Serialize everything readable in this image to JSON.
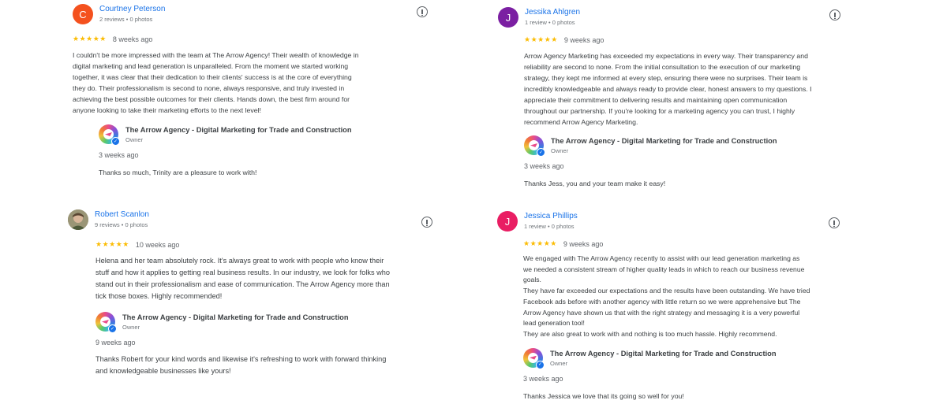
{
  "reviews": [
    {
      "avatar": {
        "letter": "C",
        "color": "#f4511e"
      },
      "name": "Courtney Peterson",
      "stats": "2 reviews • 0 photos",
      "stars": "★★★★★",
      "date": "8 weeks ago",
      "text": [
        "I couldn't be more impressed with the team at The Arrow Agency! Their wealth of knowledge in",
        "digital marketing and lead generation is unparalleled. From the moment we started working",
        "together, it was clear that their dedication to their clients' success is at the core of everything",
        "they do. Their professionalism is second to none, always responsive, and truly invested in",
        "achieving the best possible outcomes for their clients. Hands down, the best firm around for",
        "anyone looking to take their marketing efforts to the next level!"
      ],
      "owner_name": "The Arrow Agency - Digital Marketing for Trade and Construction",
      "owner_role": "Owner",
      "reply_date": "3 weeks ago",
      "reply": [
        "Thanks so much, Trinity are a pleasure to work with!"
      ]
    },
    {
      "avatar": {
        "letter": "J",
        "color": "#7b1fa2"
      },
      "name": "Jessika Ahlgren",
      "stats": "1 review • 0 photos",
      "stars": "★★★★★",
      "date": "9 weeks ago",
      "text": [
        "Arrow Agency Marketing has exceeded my expectations in every way. Their transparency and",
        "reliability are second to none. From the initial consultation to the execution of our marketing",
        "strategy, they kept me informed at every step, ensuring there were no surprises. Their team is",
        "incredibly knowledgeable and always ready to provide clear, honest answers to my questions. I",
        "appreciate their commitment to delivering results and maintaining open communication",
        "throughout our partnership. If you're looking for a marketing agency you can trust, I highly",
        "recommend Arrow Agency Marketing."
      ],
      "owner_name": "The Arrow Agency - Digital Marketing for Trade and Construction",
      "owner_role": "Owner",
      "reply_date": "3 weeks ago",
      "reply": [
        "Thanks Jess, you and your team make it easy!"
      ]
    },
    {
      "avatar": {
        "letter": "",
        "color": "#8d8a6e"
      },
      "name": "Robert Scanlon",
      "stats": "9 reviews • 0 photos",
      "stars": "★★★★★",
      "date": "10 weeks ago",
      "text": [
        "Helena and her team absolutely rock. It's always great to work with people who know their",
        "stuff and how it applies to getting real business results. In our industry, we look for folks who",
        "stand out in their professionalism and ease of communication. The Arrow Agency more than",
        "tick those boxes. Highly recommended!"
      ],
      "owner_name": "The Arrow Agency - Digital Marketing for Trade and Construction",
      "owner_role": "Owner",
      "reply_date": "9 weeks ago",
      "reply": [
        "Thanks Robert for your kind words and likewise it's refreshing to work with forward thinking",
        "and knowledgeable businesses like yours!"
      ]
    },
    {
      "avatar": {
        "letter": "J",
        "color": "#e91e63"
      },
      "name": "Jessica Phillips",
      "stats": "1 review • 0 photos",
      "stars": "★★★★★",
      "date": "9 weeks ago",
      "text": [
        "We engaged with The Arrow Agency recently to assist with our lead generation marketing as",
        "we needed a consistent stream of higher quality leads in which to reach our business revenue",
        "goals.",
        "They have far exceeded our expectations and the results have been outstanding. We have tried",
        "Facebook ads before with another agency with little return so we were apprehensive but The",
        "Arrow Agency have shown us that with the right strategy and messaging it is a very powerful",
        "lead generation tool!",
        "They are also great to work with and nothing is too much hassle. Highly recommend."
      ],
      "owner_name": "The Arrow Agency - Digital Marketing for Trade and Construction",
      "owner_role": "Owner",
      "reply_date": "3 weeks ago",
      "reply": [
        "Thanks Jessica we love that its going so well for you!"
      ]
    }
  ]
}
